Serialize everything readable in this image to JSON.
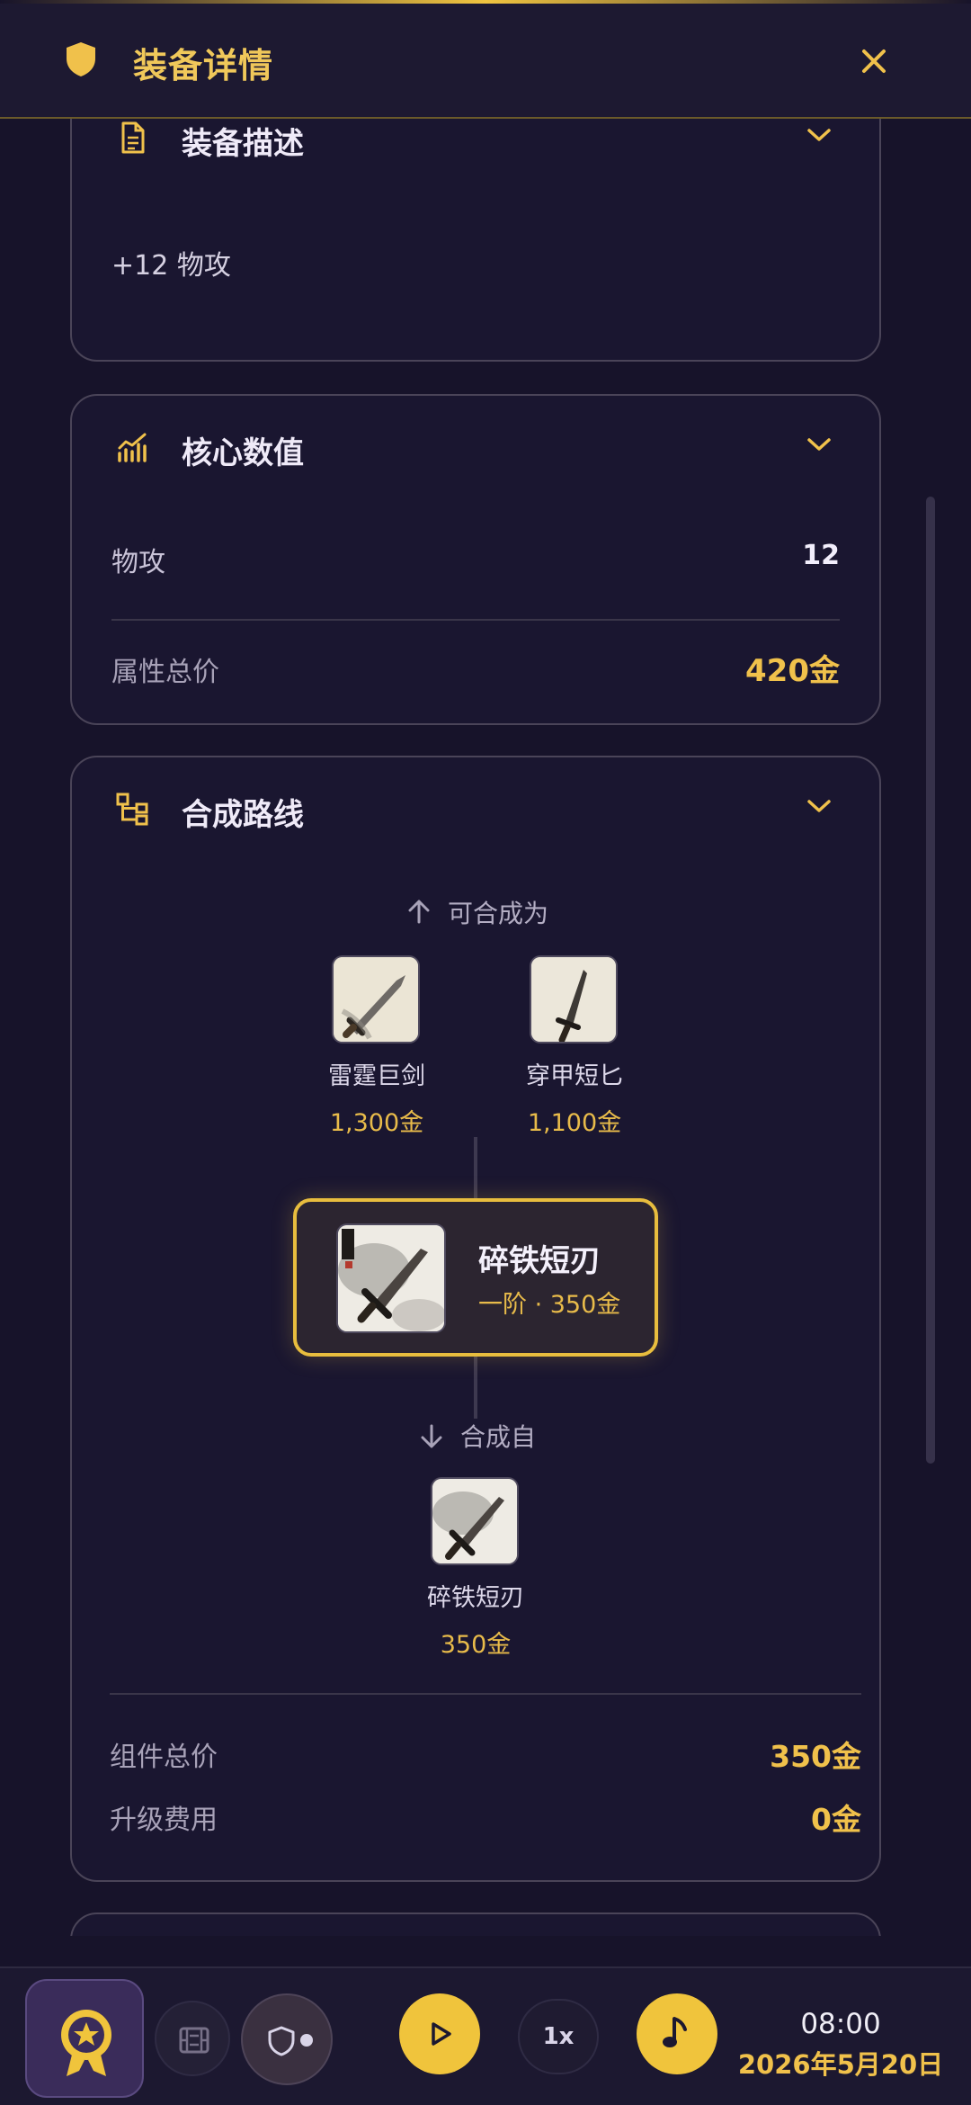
{
  "header": {
    "title": "装备详情"
  },
  "description": {
    "title": "装备描述",
    "text": "+12 物攻"
  },
  "core_stats": {
    "title": "核心数值",
    "rows": [
      {
        "label": "物攻",
        "value": "12"
      },
      {
        "label": "属性总价",
        "value": "420金"
      }
    ]
  },
  "synthesis": {
    "title": "合成路线",
    "upgrades_caption": "可合成为",
    "upgrades": [
      {
        "name": "雷霆巨剑",
        "price": "1,300金"
      },
      {
        "name": "穿甲短匕",
        "price": "1,100金"
      }
    ],
    "current": {
      "name": "碎铁短刃",
      "sub": "一阶 · 350金"
    },
    "components_caption": "合成自",
    "components": [
      {
        "name": "碎铁短刃",
        "price": "350金"
      }
    ],
    "summary": [
      {
        "label": "组件总价",
        "value": "350金"
      },
      {
        "label": "升级费用",
        "value": "0金"
      }
    ]
  },
  "bottom_bar": {
    "speed": "1x",
    "time": "08:00",
    "date": "2026年5月20日"
  },
  "colors": {
    "accent_gold": "#f0c14b",
    "background": "#17132a",
    "card_border": "#4a4458"
  }
}
